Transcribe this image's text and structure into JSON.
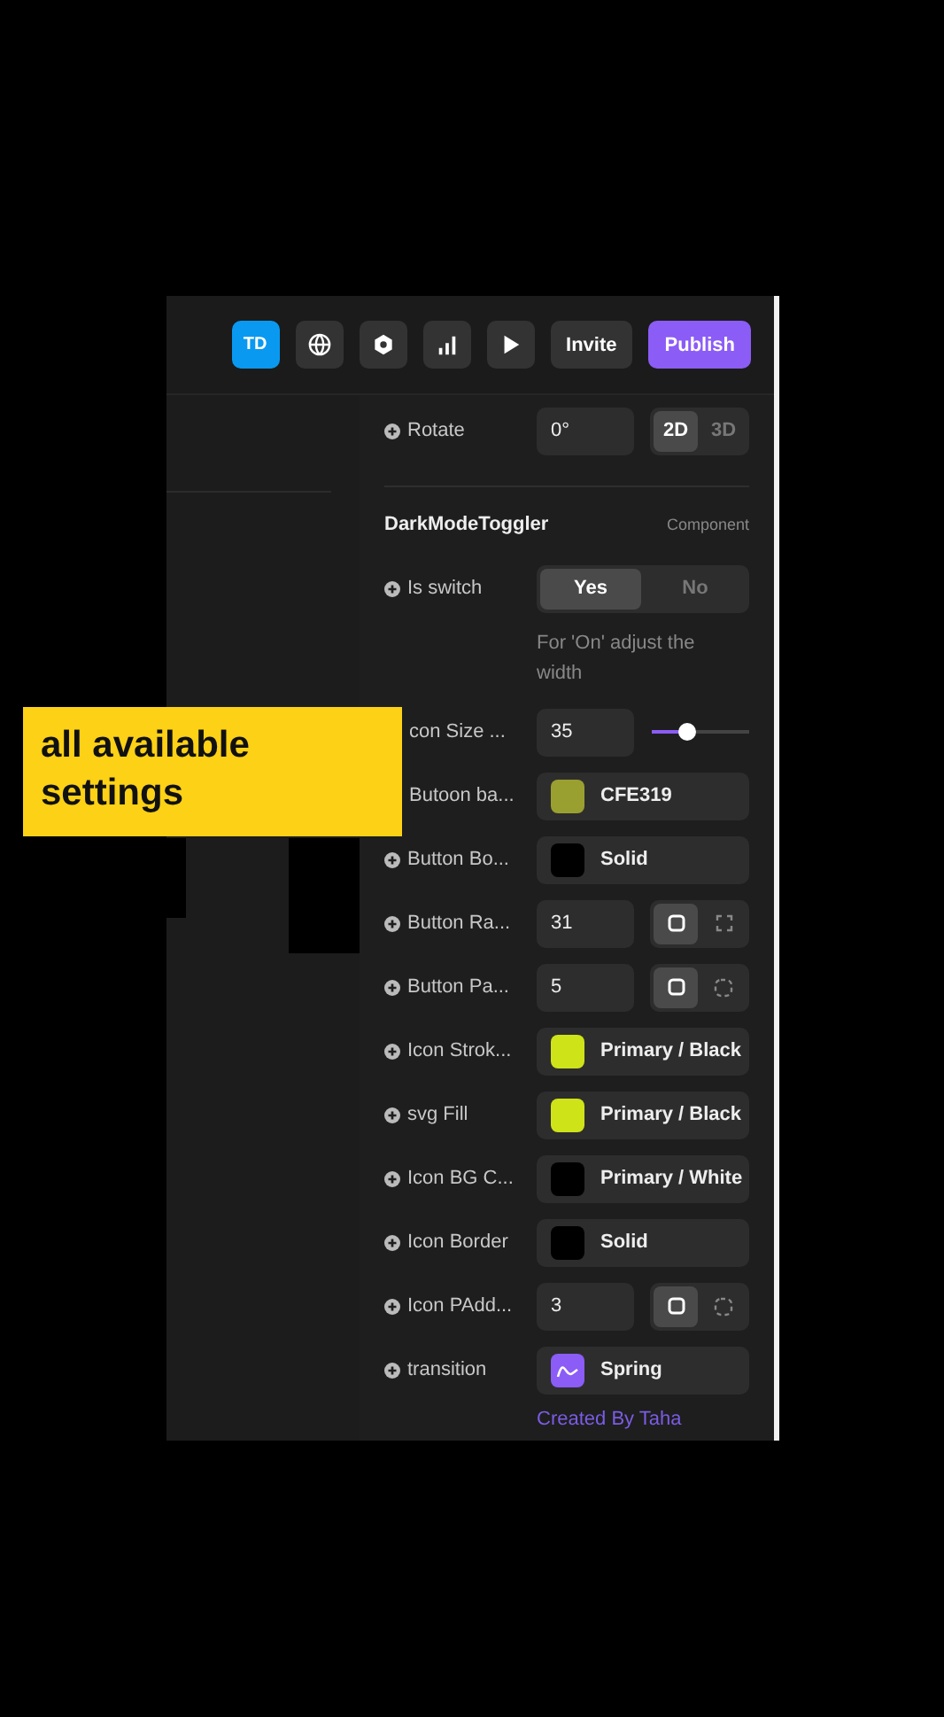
{
  "topbar": {
    "avatar": "TD",
    "icons": [
      {
        "kind": "globe"
      },
      {
        "kind": "hexagon"
      },
      {
        "kind": "chart"
      },
      {
        "kind": "play"
      }
    ],
    "buttons": [
      {
        "label": "Invite",
        "kind": "secondary"
      },
      {
        "label": "Publish",
        "kind": "primary"
      }
    ]
  },
  "rotate": {
    "label": "Rotate",
    "add_icon": true,
    "value": "0°",
    "options": [
      {
        "label": "2D",
        "selected": true
      },
      {
        "label": "3D",
        "selected": false
      }
    ]
  },
  "section": {
    "title": "DarkModeToggler",
    "tag": "Component"
  },
  "rows": [
    {
      "kind": "segmented",
      "label": "Is switch",
      "add_icon": true,
      "options": [
        {
          "label": "Yes",
          "selected": true
        },
        {
          "label": "No",
          "selected": false
        }
      ],
      "hint": "For 'On' adjust the width"
    },
    {
      "kind": "slider",
      "label": "con Size ...",
      "add_icon": false,
      "value": "35",
      "level": 0.36
    },
    {
      "kind": "color",
      "label": "Butoon ba...",
      "add_icon": false,
      "color": "#9aa030",
      "value": "CFE319"
    },
    {
      "kind": "color",
      "label": "Button Bo...",
      "add_icon": true,
      "color": "#000000",
      "value": "Solid"
    },
    {
      "kind": "number",
      "label": "Button Ra...",
      "add_icon": true,
      "value": "31",
      "modes": [
        {
          "kind": "corners",
          "selected": true
        },
        {
          "kind": "corners",
          "selected": false
        }
      ]
    },
    {
      "kind": "number",
      "label": "Button Pa...",
      "add_icon": true,
      "value": "5",
      "modes": [
        {
          "kind": "padding",
          "selected": true
        },
        {
          "kind": "padding",
          "selected": false
        }
      ]
    },
    {
      "kind": "color",
      "label": "Icon Strok...",
      "add_icon": true,
      "color": "#cfe319",
      "value": "Primary / Black"
    },
    {
      "kind": "color",
      "label": "svg Fill",
      "add_icon": true,
      "color": "#cfe319",
      "value": "Primary / Black"
    },
    {
      "kind": "color",
      "label": "Icon BG C...",
      "add_icon": true,
      "color": "#000000",
      "value": "Primary / White"
    },
    {
      "kind": "color",
      "label": "Icon Border",
      "add_icon": true,
      "color": "#000000",
      "value": "Solid"
    },
    {
      "kind": "number",
      "label": "Icon PAdd...",
      "add_icon": true,
      "value": "3",
      "modes": [
        {
          "kind": "padding",
          "selected": true
        },
        {
          "kind": "padding",
          "selected": false
        }
      ]
    },
    {
      "kind": "transition",
      "label": "transition",
      "add_icon": true,
      "color": "#8b5cf6",
      "value": "Spring"
    }
  ],
  "footer": "Created By Taha",
  "caption": "all available settings"
}
